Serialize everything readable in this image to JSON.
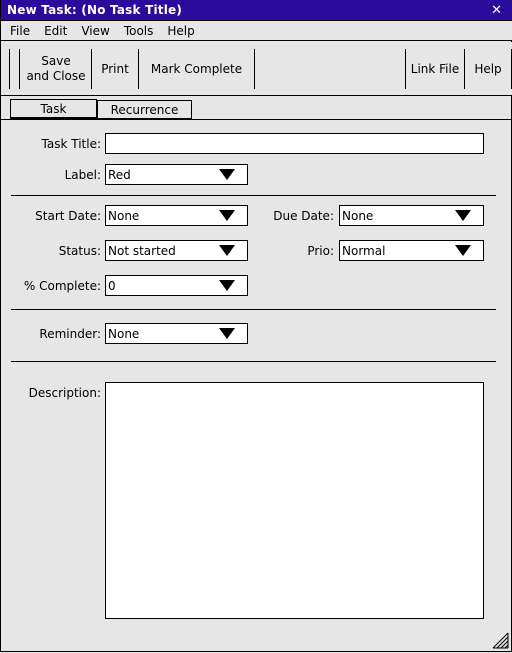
{
  "window": {
    "title": "New Task: (No Task Title)",
    "close_label": "✕"
  },
  "menubar": {
    "items": [
      {
        "label": "File"
      },
      {
        "label": "Edit"
      },
      {
        "label": "View"
      },
      {
        "label": "Tools"
      },
      {
        "label": "Help"
      }
    ]
  },
  "toolbar": {
    "save_and_close": "Save\nand Close",
    "print": "Print",
    "mark_complete": "Mark Complete",
    "link_file": "Link File",
    "help": "Help"
  },
  "tabs": [
    {
      "label": "Task",
      "selected": true
    },
    {
      "label": "Recurrence",
      "selected": false
    }
  ],
  "form": {
    "task_title": {
      "label": "Task  Title:",
      "value": "",
      "placeholder": ""
    },
    "label_field": {
      "label": "Label:",
      "value": "Red",
      "options": [
        "Red"
      ]
    },
    "start_date": {
      "label": "Start Date:",
      "value": "None",
      "options": [
        "None"
      ]
    },
    "due_date": {
      "label": "Due Date:",
      "value": "None",
      "options": [
        "None"
      ]
    },
    "status": {
      "label": "Status:",
      "value": "Not started",
      "options": [
        "Not started"
      ]
    },
    "priority": {
      "label": "Prio:",
      "value": "Normal",
      "options": [
        "Normal"
      ]
    },
    "percent_complete": {
      "label": "% Complete:",
      "value": "0",
      "options": [
        "0"
      ]
    },
    "reminder": {
      "label": "Reminder:",
      "value": "None",
      "options": [
        "None"
      ]
    },
    "description": {
      "label": "Description:",
      "value": "",
      "placeholder": ""
    }
  },
  "colors": {
    "titlebar_bg": "#2b0b9b",
    "titlebar_text": "#ffffff",
    "window_bg": "#e6e6e6",
    "field_bg": "#ffffff",
    "border": "#000000"
  }
}
